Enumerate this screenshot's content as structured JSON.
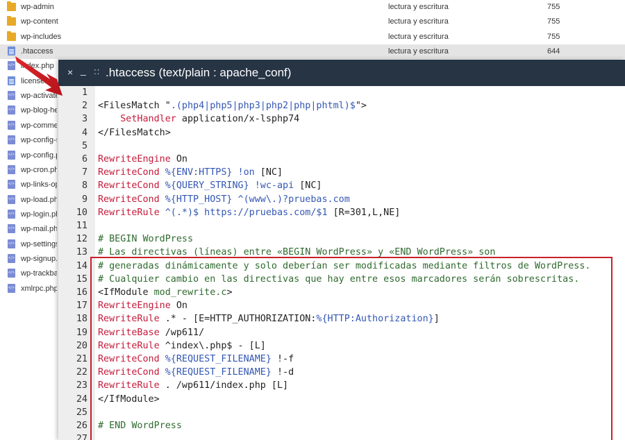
{
  "file_manager": {
    "rows": [
      {
        "name": "wp-admin",
        "icon": "folder-icon",
        "perm": "lectura y escritura",
        "octal": "755"
      },
      {
        "name": "wp-content",
        "icon": "folder-icon",
        "perm": "lectura y escritura",
        "octal": "755"
      },
      {
        "name": "wp-includes",
        "icon": "folder-icon",
        "perm": "lectura y escritura",
        "octal": "755"
      },
      {
        "name": ".htaccess",
        "icon": "text-file-icon",
        "perm": "lectura y escritura",
        "octal": "644",
        "selected": true
      },
      {
        "name": "index.php",
        "icon": "php-file-icon"
      },
      {
        "name": "license.txt",
        "icon": "text-file-icon"
      },
      {
        "name": "wp-activate.php",
        "icon": "php-file-icon"
      },
      {
        "name": "wp-blog-header.php",
        "icon": "php-file-icon"
      },
      {
        "name": "wp-comments-post.php",
        "icon": "php-file-icon"
      },
      {
        "name": "wp-config-sample.php",
        "icon": "php-file-icon"
      },
      {
        "name": "wp-config.php",
        "icon": "php-file-icon"
      },
      {
        "name": "wp-cron.php",
        "icon": "php-file-icon"
      },
      {
        "name": "wp-links-opml.php",
        "icon": "php-file-icon"
      },
      {
        "name": "wp-load.php",
        "icon": "php-file-icon"
      },
      {
        "name": "wp-login.php",
        "icon": "php-file-icon"
      },
      {
        "name": "wp-mail.php",
        "icon": "php-file-icon"
      },
      {
        "name": "wp-settings.php",
        "icon": "php-file-icon"
      },
      {
        "name": "wp-signup.php",
        "icon": "php-file-icon"
      },
      {
        "name": "wp-trackback.php",
        "icon": "php-file-icon"
      },
      {
        "name": "xmlrpc.php",
        "icon": "php-file-icon"
      }
    ]
  },
  "editor": {
    "close_symbol": "×",
    "minimize_symbol": "_",
    "drag_symbol": "::",
    "title": ".htaccess (text/plain : apache_conf)",
    "colors": {
      "titlebar": "#263444",
      "keyword": "#c41a3a",
      "variable": "#3357b3",
      "comment": "#2f6a2f",
      "highlight_box": "#c8202a"
    },
    "lines": [
      [],
      [
        {
          "c": "tx",
          "t": "<FilesMatch \""
        },
        {
          "c": "vr",
          "t": ".(php4|php5|php3|php2|php|phtml)$"
        },
        {
          "c": "tx",
          "t": "\">"
        }
      ],
      [
        {
          "c": "tx",
          "t": "    "
        },
        {
          "c": "kw",
          "t": "SetHandler"
        },
        {
          "c": "tx",
          "t": " application/x-lsphp74"
        }
      ],
      [
        {
          "c": "tx",
          "t": "</FilesMatch>"
        }
      ],
      [],
      [
        {
          "c": "kw",
          "t": "RewriteEngine"
        },
        {
          "c": "tx",
          "t": " On"
        }
      ],
      [
        {
          "c": "kw",
          "t": "RewriteCond"
        },
        {
          "c": "tx",
          "t": " "
        },
        {
          "c": "vr",
          "t": "%{ENV:HTTPS} !on"
        },
        {
          "c": "tx",
          "t": " [NC]"
        }
      ],
      [
        {
          "c": "kw",
          "t": "RewriteCond"
        },
        {
          "c": "tx",
          "t": " "
        },
        {
          "c": "vr",
          "t": "%{QUERY_STRING} !wc-api"
        },
        {
          "c": "tx",
          "t": " [NC]"
        }
      ],
      [
        {
          "c": "kw",
          "t": "RewriteCond"
        },
        {
          "c": "tx",
          "t": " "
        },
        {
          "c": "vr",
          "t": "%{HTTP_HOST} ^(www\\.)?pruebas.com"
        }
      ],
      [
        {
          "c": "kw",
          "t": "RewriteRule"
        },
        {
          "c": "tx",
          "t": " "
        },
        {
          "c": "vr",
          "t": "^(.*)$ https://pruebas.com/$1"
        },
        {
          "c": "tx",
          "t": " [R=301,L,NE]"
        }
      ],
      [],
      [
        {
          "c": "cm",
          "t": "# BEGIN WordPress"
        }
      ],
      [
        {
          "c": "cm",
          "t": "# Las directivas (líneas) entre «BEGIN WordPress» y «END WordPress» son"
        }
      ],
      [
        {
          "c": "cm",
          "t": "# generadas dinámicamente y solo deberían ser modificadas mediante filtros de WordPress."
        }
      ],
      [
        {
          "c": "cm",
          "t": "# Cualquier cambio en las directivas que hay entre esos marcadores serán sobrescritas."
        }
      ],
      [
        {
          "c": "tx",
          "t": "<IfModule "
        },
        {
          "c": "cm",
          "t": "mod_rewrite.c"
        },
        {
          "c": "tx",
          "t": ">"
        }
      ],
      [
        {
          "c": "kw",
          "t": "RewriteEngine"
        },
        {
          "c": "tx",
          "t": " On"
        }
      ],
      [
        {
          "c": "kw",
          "t": "RewriteRule"
        },
        {
          "c": "tx",
          "t": " .* - [E=HTTP_AUTHORIZATION:"
        },
        {
          "c": "vr",
          "t": "%{HTTP:Authorization}"
        },
        {
          "c": "tx",
          "t": "]"
        }
      ],
      [
        {
          "c": "kw",
          "t": "RewriteBase"
        },
        {
          "c": "tx",
          "t": " /wp611/"
        }
      ],
      [
        {
          "c": "kw",
          "t": "RewriteRule"
        },
        {
          "c": "tx",
          "t": " ^index\\.php$ - [L]"
        }
      ],
      [
        {
          "c": "kw",
          "t": "RewriteCond"
        },
        {
          "c": "tx",
          "t": " "
        },
        {
          "c": "vr",
          "t": "%{REQUEST_FILENAME}"
        },
        {
          "c": "tx",
          "t": " !-f"
        }
      ],
      [
        {
          "c": "kw",
          "t": "RewriteCond"
        },
        {
          "c": "tx",
          "t": " "
        },
        {
          "c": "vr",
          "t": "%{REQUEST_FILENAME}"
        },
        {
          "c": "tx",
          "t": " !-d"
        }
      ],
      [
        {
          "c": "kw",
          "t": "RewriteRule"
        },
        {
          "c": "tx",
          "t": " . /wp611/index.php [L]"
        }
      ],
      [
        {
          "c": "tx",
          "t": "</IfModule>"
        }
      ],
      [],
      [
        {
          "c": "cm",
          "t": "# END WordPress"
        }
      ],
      []
    ]
  }
}
